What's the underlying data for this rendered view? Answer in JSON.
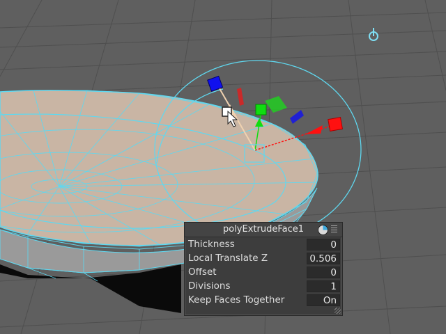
{
  "editor": {
    "title": "polyExtrudeFace1",
    "attributes": [
      {
        "label": "Thickness",
        "value": "0"
      },
      {
        "label": "Local Translate Z",
        "value": "0.506"
      },
      {
        "label": "Offset",
        "value": "0"
      },
      {
        "label": "Divisions",
        "value": "1"
      },
      {
        "label": "Keep Faces Together",
        "value": "On"
      }
    ]
  },
  "colors": {
    "viewport_background": "#5f5f5f",
    "grid": "#4e4e4e",
    "wireframe_highlight": "#5fd8f0",
    "face_selected": "#c9b5a4",
    "axis_x": "#ff1010",
    "axis_y": "#10dd10",
    "axis_z": "#1010ee",
    "handle_center": "#f0d2b0"
  },
  "icons": {
    "pivot": "pivot-icon",
    "panel_badge": "attribute-icon",
    "panel_menu": "menu-icon"
  }
}
